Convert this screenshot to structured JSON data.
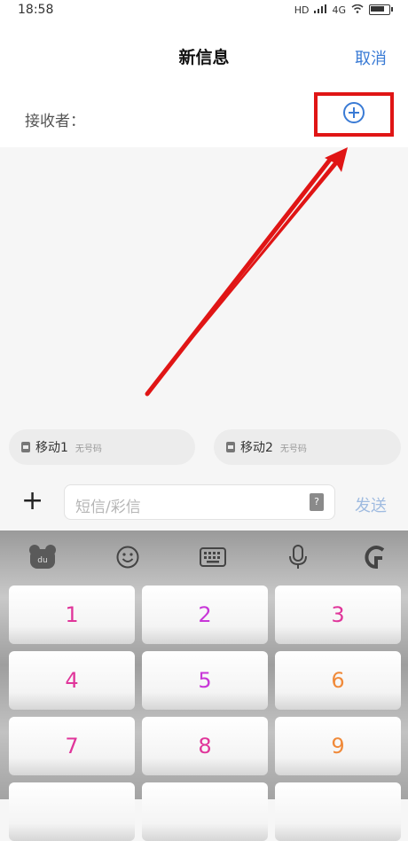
{
  "status_bar": {
    "time": "18:58",
    "network": "HD",
    "signal_label": "4G"
  },
  "header": {
    "title": "新信息",
    "cancel_label": "取消"
  },
  "recipient": {
    "label": "接收者：",
    "add_icon": "plus-circle-icon"
  },
  "sim_cards": [
    {
      "name": "移动1",
      "number": "无号码"
    },
    {
      "name": "移动2",
      "number": "无号码"
    }
  ],
  "compose": {
    "plus_label": "+",
    "placeholder": "短信/彩信",
    "send_label": "发送"
  },
  "keyboard": {
    "toolbar_icons": [
      "bear-logo-icon",
      "emoji-icon",
      "keyboard-icon",
      "microphone-icon",
      "g-logo-icon"
    ],
    "keys": [
      "1",
      "2",
      "3",
      "4",
      "5",
      "6",
      "7",
      "8",
      "9"
    ],
    "key_colors": [
      "#e0359a",
      "#c837d8",
      "#e0359a",
      "#e0359a",
      "#c837d8",
      "#f08a3a",
      "#e0359a",
      "#e0359a",
      "#f08a3a"
    ]
  },
  "colors": {
    "accent": "#3a7bd5",
    "highlight": "#e01515",
    "send_disabled": "#9fbbe0"
  }
}
